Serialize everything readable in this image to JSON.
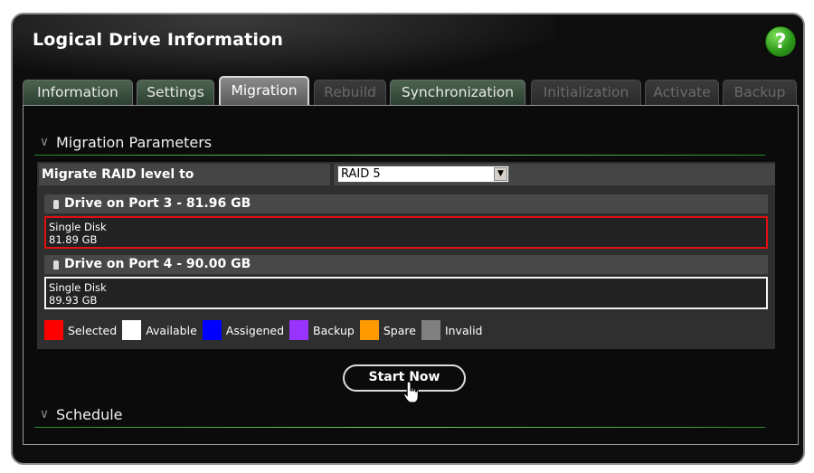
{
  "window": {
    "title": "Logical Drive Information",
    "help_label": "?"
  },
  "tabs": [
    {
      "label": "Information",
      "state": "enabled"
    },
    {
      "label": "Settings",
      "state": "enabled"
    },
    {
      "label": "Migration",
      "state": "active"
    },
    {
      "label": "Rebuild",
      "state": "disabled"
    },
    {
      "label": "Synchronization",
      "state": "enabled"
    },
    {
      "label": "Initialization",
      "state": "disabled"
    },
    {
      "label": "Activate",
      "state": "disabled"
    },
    {
      "label": "Backup",
      "state": "disabled"
    }
  ],
  "migration": {
    "section_title": "Migration Parameters",
    "raid_label": "Migrate RAID level to",
    "raid_value": "RAID 5",
    "drives": [
      {
        "header": "Drive on Port 3 - 81.96 GB",
        "type": "Single Disk",
        "size": "81.89 GB",
        "state": "selected"
      },
      {
        "header": "Drive on Port 4 - 90.00 GB",
        "type": "Single Disk",
        "size": "89.93 GB",
        "state": "available"
      }
    ],
    "legend": [
      {
        "label": "Selected",
        "color": "#ff0000"
      },
      {
        "label": "Available",
        "color": "#ffffff"
      },
      {
        "label": "Assigened",
        "color": "#0000ff"
      },
      {
        "label": "Backup",
        "color": "#9933ff"
      },
      {
        "label": "Spare",
        "color": "#ff9900"
      },
      {
        "label": "Invalid",
        "color": "#808080"
      }
    ]
  },
  "actions": {
    "start_label": "Start Now"
  },
  "schedule": {
    "section_title": "Schedule"
  }
}
